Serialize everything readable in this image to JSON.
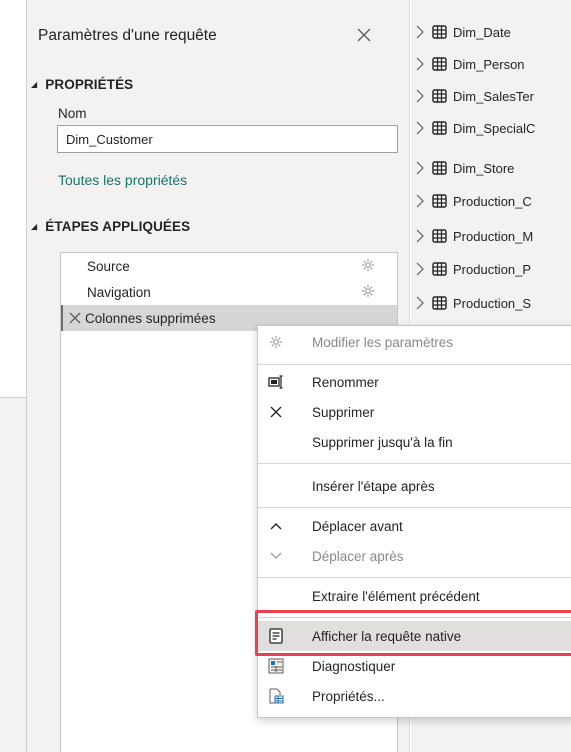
{
  "query_settings": {
    "title": "Paramètres d'une requête",
    "properties_heading": "PROPRIÉTÉS",
    "name_label": "Nom",
    "name_value": "Dim_Customer",
    "all_properties_link": "Toutes les propriétés",
    "applied_steps_heading": "ÉTAPES APPLIQUÉES",
    "steps": [
      {
        "label": "Source"
      },
      {
        "label": "Navigation"
      },
      {
        "label": "Colonnes supprimées"
      }
    ]
  },
  "navigator": {
    "items": [
      "Dim_Date",
      "Dim_Person",
      "Dim_SalesTer",
      "Dim_SpecialC",
      "Dim_Store",
      "Production_C",
      "Production_M",
      "Production_P",
      "Production_S"
    ]
  },
  "context_menu": {
    "items": [
      {
        "label": "Modifier les paramètres",
        "icon": "gear-icon",
        "disabled": true
      },
      {
        "label": "Renommer",
        "icon": "rename-icon"
      },
      {
        "label": "Supprimer",
        "icon": "close-icon"
      },
      {
        "label": "Supprimer jusqu'à la fin",
        "icon": ""
      },
      {
        "label": "Insérer l'étape après",
        "icon": ""
      },
      {
        "label": "Déplacer avant",
        "icon": "chevron-up-icon"
      },
      {
        "label": "Déplacer après",
        "icon": "chevron-down-icon",
        "disabled": true
      },
      {
        "label": "Extraire l'élément précédent",
        "icon": ""
      },
      {
        "label": "Afficher la requête native",
        "icon": "native-query-icon",
        "highlighted": true
      },
      {
        "label": "Diagnostiquer",
        "icon": "diagnostics-icon"
      },
      {
        "label": "Propriétés...",
        "icon": "properties-icon"
      }
    ]
  },
  "colors": {
    "pane_background": "#f3f2f1",
    "link": "#1a7169",
    "highlight_border": "#e8414f",
    "selected_step": "#d7d6d5"
  }
}
